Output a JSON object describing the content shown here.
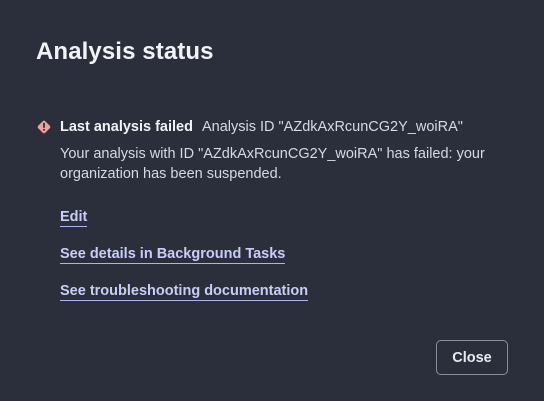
{
  "dialog": {
    "title": "Analysis status"
  },
  "status": {
    "icon": "error-diamond-icon",
    "icon_color": "#f0a09a",
    "title": "Last analysis failed",
    "analysis_id_text": "Analysis ID \"AZdkAxRcunCG2Y_woiRA\"",
    "message": "Your analysis with ID \"AZdkAxRcunCG2Y_woiRA\" has failed: your organization has been suspended."
  },
  "links": {
    "edit": "Edit",
    "background_tasks": "See details in Background Tasks",
    "troubleshooting": "See troubleshooting documentation"
  },
  "footer": {
    "close_label": "Close"
  },
  "colors": {
    "background": "#2b2f3b",
    "link": "#c9cdf7",
    "text": "#e9ebf1"
  }
}
